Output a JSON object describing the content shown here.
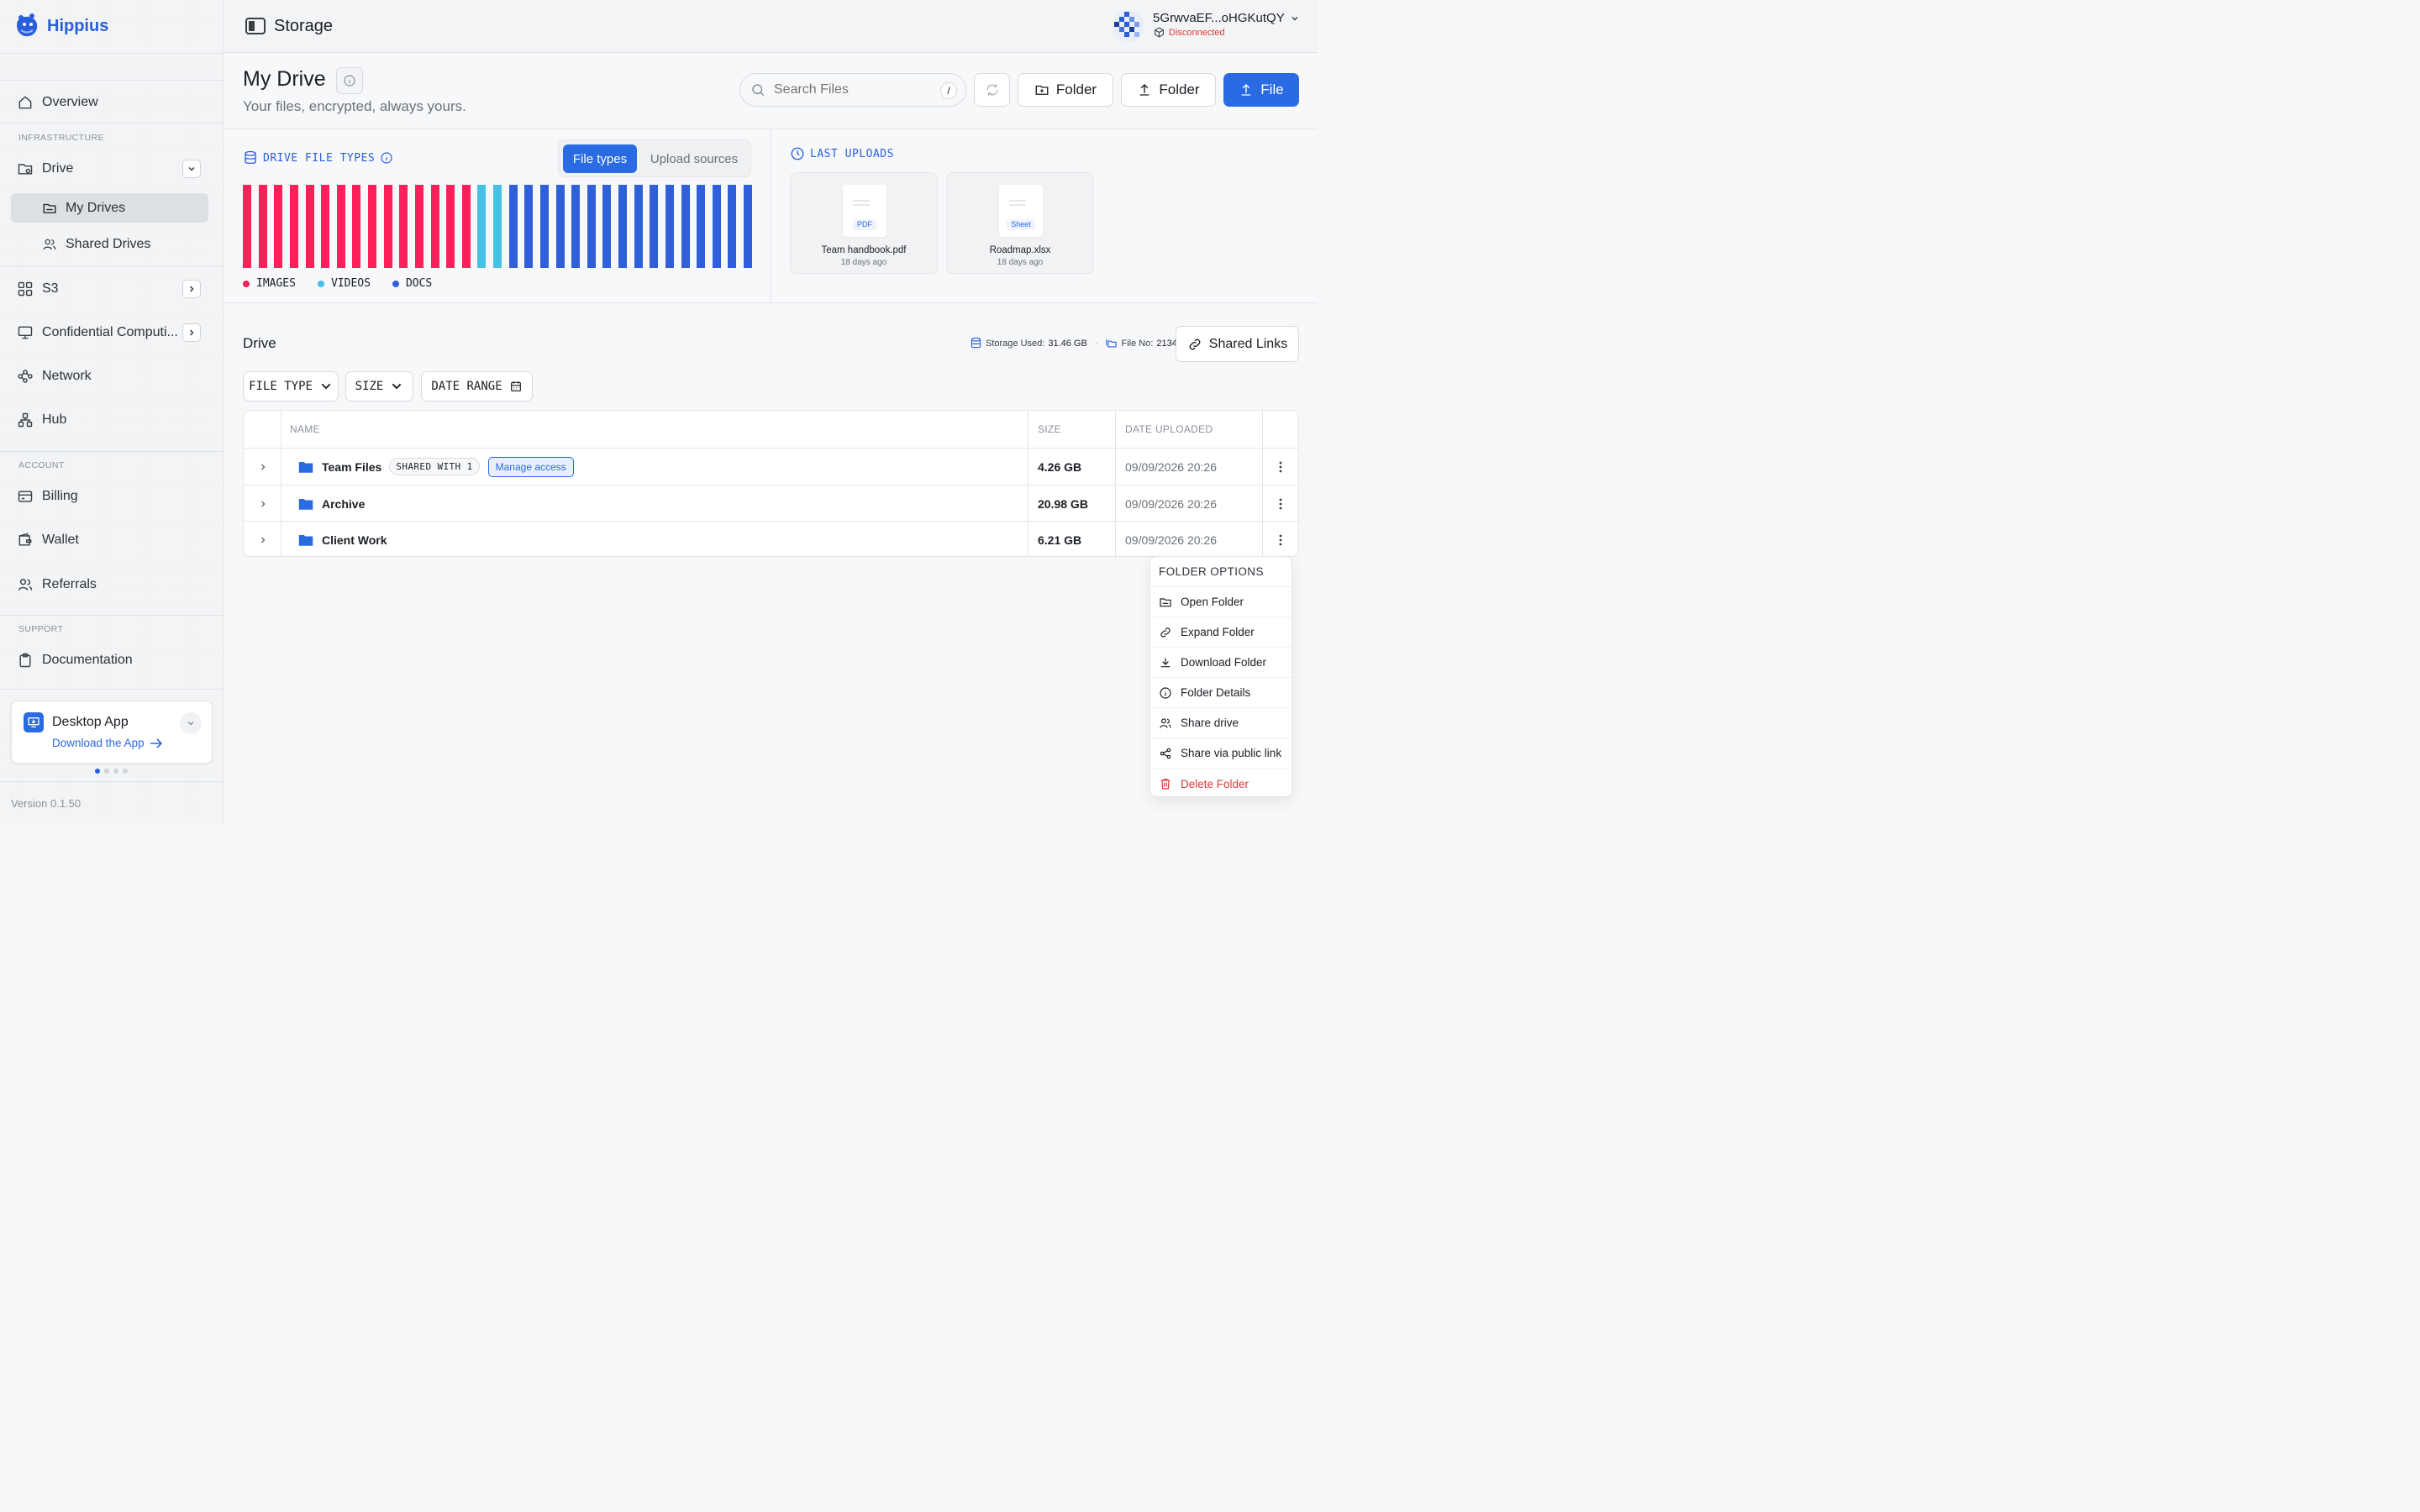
{
  "app": {
    "name": "Hippius",
    "version": "Version 0.1.50"
  },
  "topbar": {
    "title": "Storage",
    "account_name": "5GrwvaEF...oHGKutQY",
    "account_status": "Disconnected"
  },
  "sidebar": {
    "overview": "Overview",
    "section_infrastructure": "INFRASTRUCTURE",
    "drive": "Drive",
    "my_drives": "My Drives",
    "shared_drives": "Shared Drives",
    "s3": "S3",
    "confidential": "Confidential Computi...",
    "network": "Network",
    "hub": "Hub",
    "section_account": "ACCOUNT",
    "billing": "Billing",
    "wallet": "Wallet",
    "referrals": "Referrals",
    "section_support": "SUPPORT",
    "documentation": "Documentation",
    "desktop_title": "Desktop App",
    "desktop_link": "Download the App"
  },
  "header": {
    "title": "My Drive",
    "subtitle": "Your files, encrypted, always yours.",
    "search_placeholder": "Search Files",
    "search_shortcut": "/",
    "new_folder": "Folder",
    "upload_folder": "Folder",
    "upload_file": "File"
  },
  "file_types": {
    "title": "DRIVE FILE TYPES",
    "tab_active": "File types",
    "tab_other": "Upload sources",
    "legend": [
      {
        "label": "IMAGES",
        "color": "#ff1f5a"
      },
      {
        "label": "VIDEOS",
        "color": "#45c1e6"
      },
      {
        "label": "DOCS",
        "color": "#2f5fd9"
      }
    ],
    "segments": {
      "images": 15,
      "videos": 2,
      "docs": 16
    }
  },
  "last_uploads": {
    "title": "LAST UPLOADS",
    "files": [
      {
        "name": "Team handbook.pdf",
        "time": "18 days ago",
        "tag": "PDF"
      },
      {
        "name": "Roadmap.xlsx",
        "time": "18 days ago",
        "tag": "Sheet"
      }
    ]
  },
  "drive": {
    "title": "Drive",
    "storage_used_label": "Storage Used:",
    "storage_used": "31.46 GB",
    "file_no_label": "File No:",
    "file_no": "2134",
    "shared_links": "Shared Links",
    "filters": {
      "file_type": "FILE TYPE",
      "size": "SIZE",
      "date_range": "DATE RANGE"
    },
    "columns": {
      "name": "NAME",
      "size": "SIZE",
      "date": "DATE UPLOADED"
    },
    "rows": [
      {
        "name": "Team Files",
        "badge": "SHARED WITH 1",
        "action": "Manage access",
        "size": "4.26 GB",
        "date": "09/09/2026 20:26"
      },
      {
        "name": "Archive",
        "size": "20.98 GB",
        "date": "09/09/2026 20:26"
      },
      {
        "name": "Client Work",
        "size": "6.21 GB",
        "date": "09/09/2026 20:26"
      }
    ]
  },
  "folder_menu": {
    "title": "FOLDER OPTIONS",
    "items": [
      "Open Folder",
      "Expand Folder",
      "Download Folder",
      "Folder Details",
      "Share drive",
      "Share via public link",
      "Delete Folder"
    ]
  }
}
